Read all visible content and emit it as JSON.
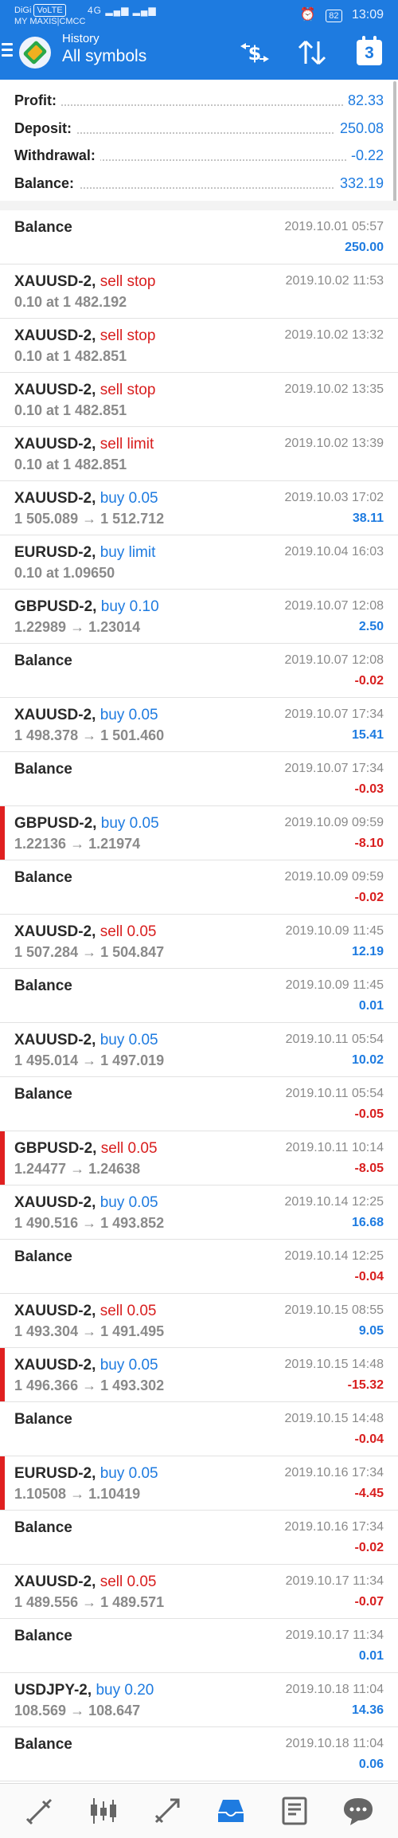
{
  "status_bar": {
    "carrier_line1": "DiGi",
    "carrier_badge": "VoLTE",
    "carrier_line2": "MY MAXIS|CMCC",
    "network": "4G",
    "alarm_icon": "alarm-icon",
    "battery": "82",
    "time": "13:09"
  },
  "header": {
    "subtitle": "History",
    "title": "All symbols",
    "calendar_day": "3"
  },
  "summary": [
    {
      "label": "Profit:",
      "value": "82.33"
    },
    {
      "label": "Deposit:",
      "value": "250.08"
    },
    {
      "label": "Withdrawal:",
      "value": "-0.22"
    },
    {
      "label": "Balance:",
      "value": "332.19"
    }
  ],
  "entries": [
    {
      "symbol": "Balance",
      "type": "",
      "type_color": "",
      "detail": "",
      "date": "2019.10.01 05:57",
      "amount": "250.00",
      "amount_color": "blue",
      "flag": false
    },
    {
      "symbol": "XAUUSD-2,",
      "type": "sell stop",
      "type_color": "red",
      "detail": "0.10 at 1 482.192",
      "date": "2019.10.02 11:53",
      "amount": "",
      "amount_color": "",
      "flag": false
    },
    {
      "symbol": "XAUUSD-2,",
      "type": "sell stop",
      "type_color": "red",
      "detail": "0.10 at 1 482.851",
      "date": "2019.10.02 13:32",
      "amount": "",
      "amount_color": "",
      "flag": false
    },
    {
      "symbol": "XAUUSD-2,",
      "type": "sell stop",
      "type_color": "red",
      "detail": "0.10 at 1 482.851",
      "date": "2019.10.02 13:35",
      "amount": "",
      "amount_color": "",
      "flag": false
    },
    {
      "symbol": "XAUUSD-2,",
      "type": "sell limit",
      "type_color": "red",
      "detail": "0.10 at 1 482.851",
      "date": "2019.10.02 13:39",
      "amount": "",
      "amount_color": "",
      "flag": false
    },
    {
      "symbol": "XAUUSD-2,",
      "type": "buy 0.05",
      "type_color": "blue",
      "detail": "1 505.089 → 1 512.712",
      "date": "2019.10.03 17:02",
      "amount": "38.11",
      "amount_color": "blue",
      "flag": false
    },
    {
      "symbol": "EURUSD-2,",
      "type": "buy limit",
      "type_color": "blue",
      "detail": "0.10 at 1.09650",
      "date": "2019.10.04 16:03",
      "amount": "",
      "amount_color": "",
      "flag": false
    },
    {
      "symbol": "GBPUSD-2,",
      "type": "buy 0.10",
      "type_color": "blue",
      "detail": "1.22989 → 1.23014",
      "date": "2019.10.07 12:08",
      "amount": "2.50",
      "amount_color": "blue",
      "flag": false
    },
    {
      "symbol": "Balance",
      "type": "",
      "type_color": "",
      "detail": "",
      "date": "2019.10.07 12:08",
      "amount": "-0.02",
      "amount_color": "red",
      "flag": false
    },
    {
      "symbol": "XAUUSD-2,",
      "type": "buy 0.05",
      "type_color": "blue",
      "detail": "1 498.378 → 1 501.460",
      "date": "2019.10.07 17:34",
      "amount": "15.41",
      "amount_color": "blue",
      "flag": false
    },
    {
      "symbol": "Balance",
      "type": "",
      "type_color": "",
      "detail": "",
      "date": "2019.10.07 17:34",
      "amount": "-0.03",
      "amount_color": "red",
      "flag": false
    },
    {
      "symbol": "GBPUSD-2,",
      "type": "buy 0.05",
      "type_color": "blue",
      "detail": "1.22136 → 1.21974",
      "date": "2019.10.09 09:59",
      "amount": "-8.10",
      "amount_color": "red",
      "flag": true
    },
    {
      "symbol": "Balance",
      "type": "",
      "type_color": "",
      "detail": "",
      "date": "2019.10.09 09:59",
      "amount": "-0.02",
      "amount_color": "red",
      "flag": false
    },
    {
      "symbol": "XAUUSD-2,",
      "type": "sell 0.05",
      "type_color": "red",
      "detail": "1 507.284 → 1 504.847",
      "date": "2019.10.09 11:45",
      "amount": "12.19",
      "amount_color": "blue",
      "flag": false
    },
    {
      "symbol": "Balance",
      "type": "",
      "type_color": "",
      "detail": "",
      "date": "2019.10.09 11:45",
      "amount": "0.01",
      "amount_color": "blue",
      "flag": false
    },
    {
      "symbol": "XAUUSD-2,",
      "type": "buy 0.05",
      "type_color": "blue",
      "detail": "1 495.014 → 1 497.019",
      "date": "2019.10.11 05:54",
      "amount": "10.02",
      "amount_color": "blue",
      "flag": false
    },
    {
      "symbol": "Balance",
      "type": "",
      "type_color": "",
      "detail": "",
      "date": "2019.10.11 05:54",
      "amount": "-0.05",
      "amount_color": "red",
      "flag": false
    },
    {
      "symbol": "GBPUSD-2,",
      "type": "sell 0.05",
      "type_color": "red",
      "detail": "1.24477 → 1.24638",
      "date": "2019.10.11 10:14",
      "amount": "-8.05",
      "amount_color": "red",
      "flag": true
    },
    {
      "symbol": "XAUUSD-2,",
      "type": "buy 0.05",
      "type_color": "blue",
      "detail": "1 490.516 → 1 493.852",
      "date": "2019.10.14 12:25",
      "amount": "16.68",
      "amount_color": "blue",
      "flag": false
    },
    {
      "symbol": "Balance",
      "type": "",
      "type_color": "",
      "detail": "",
      "date": "2019.10.14 12:25",
      "amount": "-0.04",
      "amount_color": "red",
      "flag": false
    },
    {
      "symbol": "XAUUSD-2,",
      "type": "sell 0.05",
      "type_color": "red",
      "detail": "1 493.304 → 1 491.495",
      "date": "2019.10.15 08:55",
      "amount": "9.05",
      "amount_color": "blue",
      "flag": false
    },
    {
      "symbol": "XAUUSD-2,",
      "type": "buy 0.05",
      "type_color": "blue",
      "detail": "1 496.366 → 1 493.302",
      "date": "2019.10.15 14:48",
      "amount": "-15.32",
      "amount_color": "red",
      "flag": true
    },
    {
      "symbol": "Balance",
      "type": "",
      "type_color": "",
      "detail": "",
      "date": "2019.10.15 14:48",
      "amount": "-0.04",
      "amount_color": "red",
      "flag": false
    },
    {
      "symbol": "EURUSD-2,",
      "type": "buy 0.05",
      "type_color": "blue",
      "detail": "1.10508 → 1.10419",
      "date": "2019.10.16 17:34",
      "amount": "-4.45",
      "amount_color": "red",
      "flag": true
    },
    {
      "symbol": "Balance",
      "type": "",
      "type_color": "",
      "detail": "",
      "date": "2019.10.16 17:34",
      "amount": "-0.02",
      "amount_color": "red",
      "flag": false
    },
    {
      "symbol": "XAUUSD-2,",
      "type": "sell 0.05",
      "type_color": "red",
      "detail": "1 489.556 → 1 489.571",
      "date": "2019.10.17 11:34",
      "amount": "-0.07",
      "amount_color": "red",
      "flag": false
    },
    {
      "symbol": "Balance",
      "type": "",
      "type_color": "",
      "detail": "",
      "date": "2019.10.17 11:34",
      "amount": "0.01",
      "amount_color": "blue",
      "flag": false
    },
    {
      "symbol": "USDJPY-2,",
      "type": "buy 0.20",
      "type_color": "blue",
      "detail": "108.569 → 108.647",
      "date": "2019.10.18 11:04",
      "amount": "14.36",
      "amount_color": "blue",
      "flag": false
    },
    {
      "symbol": "Balance",
      "type": "",
      "type_color": "",
      "detail": "",
      "date": "2019.10.18 11:04",
      "amount": "0.06",
      "amount_color": "blue",
      "flag": false
    }
  ],
  "bottom_nav": [
    "quotes-icon",
    "chart-icon",
    "trade-icon",
    "history-icon",
    "news-icon",
    "chat-icon"
  ],
  "colors": {
    "accent": "#1e7be0",
    "negative": "#d81e1e",
    "muted": "#8a8a8a"
  }
}
